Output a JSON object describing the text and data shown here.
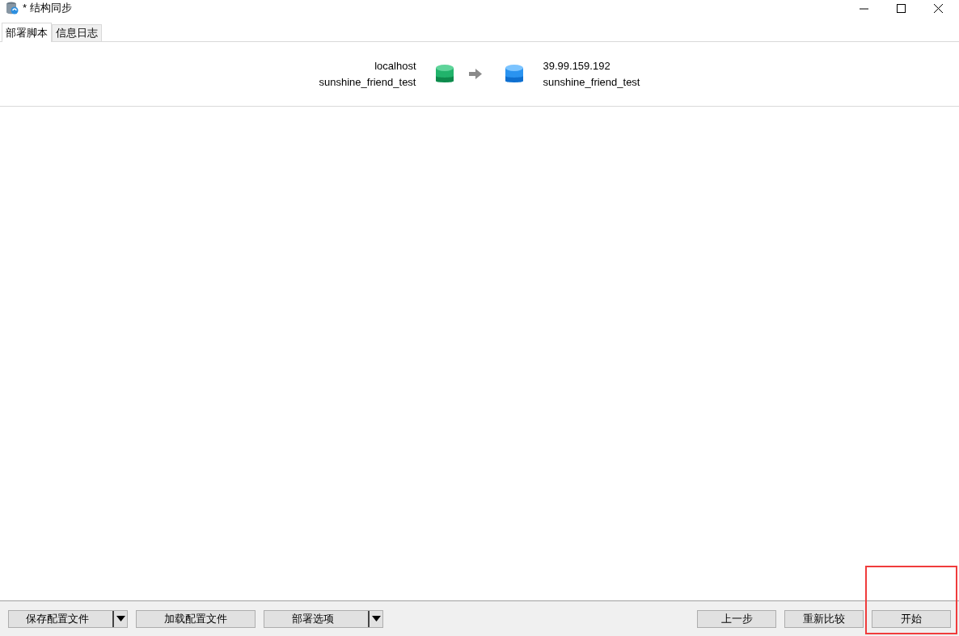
{
  "window": {
    "title": "* 结构同步"
  },
  "tabs": [
    {
      "label": "部署脚本",
      "selected": true
    },
    {
      "label": "信息日志",
      "selected": false
    }
  ],
  "source": {
    "host": "localhost",
    "database": "sunshine_friend_test"
  },
  "target": {
    "host": "39.99.159.192",
    "database": "sunshine_friend_test"
  },
  "left_buttons": [
    {
      "label": "保存配置文件",
      "kind": "split"
    },
    {
      "label": "加载配置文件",
      "kind": "plain"
    },
    {
      "label": "部署选项",
      "kind": "split"
    }
  ],
  "right_buttons": [
    {
      "label": "上一步"
    },
    {
      "label": "重新比较"
    },
    {
      "label": "开始"
    }
  ]
}
